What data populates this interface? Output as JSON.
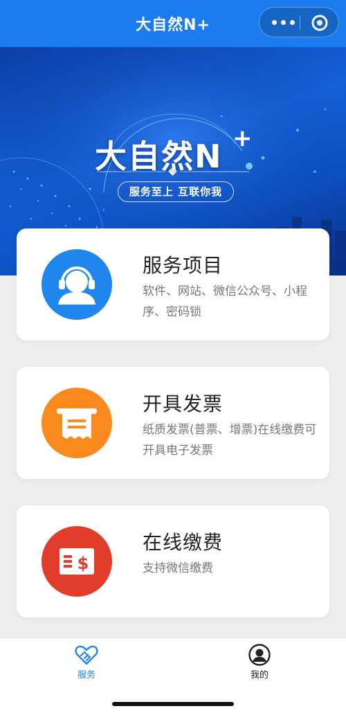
{
  "nav": {
    "title": "大自然N+"
  },
  "banner": {
    "title": "大自然N",
    "plus": "+",
    "slogan": "服务至上  互联你我"
  },
  "cards": [
    {
      "title": "服务项目",
      "desc": "软件、网站、微信公众号、小程序、密码锁",
      "icon": "customer-service-icon",
      "color": "#1f86ee"
    },
    {
      "title": "开具发票",
      "desc": "纸质发票(普票、增票)在线缴费可开具电子发票",
      "icon": "invoice-icon",
      "color": "#fb8a1e"
    },
    {
      "title": "在线缴费",
      "desc": "支持微信缴费",
      "icon": "payment-icon",
      "color": "#e23c2c"
    }
  ],
  "tabs": [
    {
      "label": "服务",
      "icon": "handshake-icon",
      "active": true,
      "color": "#1f86ee"
    },
    {
      "label": "我的",
      "icon": "user-icon",
      "active": false,
      "color": "#222222"
    }
  ]
}
